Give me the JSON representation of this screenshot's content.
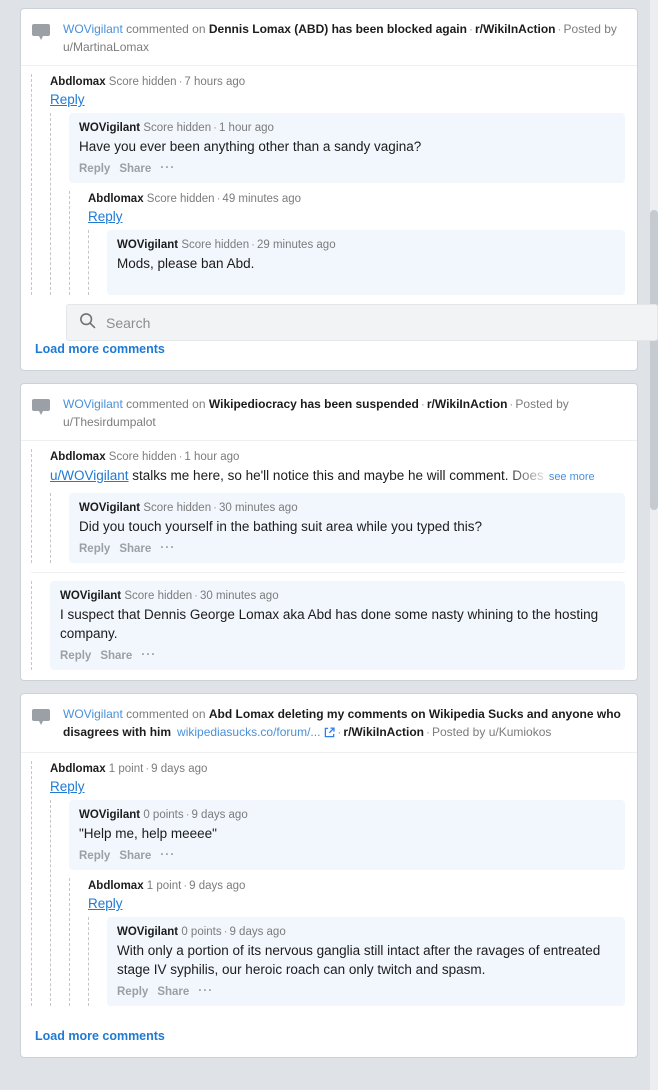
{
  "search": {
    "placeholder": "Search",
    "value": "",
    "icon": "search-icon"
  },
  "scroll": {
    "position_label": ""
  },
  "cards": [
    {
      "header": {
        "icon": "comment-bubble-icon",
        "user": "WOVigilant",
        "action": "commented on",
        "post_title": "Dennis Lomax (ABD) has been blocked again",
        "link_text": "",
        "link_icon": "",
        "subreddit": "r/WikiInAction",
        "posted_by_label": "Posted by",
        "poster": "u/MartinaLomax"
      },
      "load_more": "Load more comments",
      "comments": [
        {
          "author": "Abdlomax",
          "score": "Score hidden",
          "time": "7 hours ago",
          "reply_link": "Reply",
          "text": "",
          "highlighted": false,
          "actions": [],
          "depth": 0
        },
        {
          "author": "WOVigilant",
          "score": "Score hidden",
          "time": "1 hour ago",
          "reply_link": "",
          "text": "Have you ever been anything other than a sandy vagina?",
          "highlighted": true,
          "actions": [
            "Reply",
            "Share",
            "···"
          ],
          "depth": 1
        },
        {
          "author": "Abdlomax",
          "score": "Score hidden",
          "time": "49 minutes ago",
          "reply_link": "Reply",
          "text": "",
          "highlighted": false,
          "actions": [],
          "depth": 2
        },
        {
          "author": "WOVigilant",
          "score": "Score hidden",
          "time": "29 minutes ago",
          "reply_link": "",
          "text": "Mods, please ban Abd.",
          "highlighted": true,
          "actions": [],
          "depth": 3
        }
      ]
    },
    {
      "header": {
        "icon": "comment-bubble-icon",
        "user": "WOVigilant",
        "action": "commented on",
        "post_title": "Wikipediocracy has been suspended",
        "link_text": "",
        "link_icon": "",
        "subreddit": "r/WikiInAction",
        "posted_by_label": "Posted by",
        "poster": "u/Thesirdumpalot"
      },
      "load_more": "",
      "comments": [
        {
          "author": "Abdlomax",
          "score": "Score hidden",
          "time": "1 hour ago",
          "reply_link": "",
          "text_prefix_link": "u/WOVigilant",
          "text": " stalks me here, so he'll notice this and maybe he will comment. Does",
          "see_more": "see more",
          "truncated": true,
          "highlighted": false,
          "actions": [],
          "depth": 0
        },
        {
          "author": "WOVigilant",
          "score": "Score hidden",
          "time": "30 minutes ago",
          "reply_link": "",
          "text": "Did you touch yourself in the bathing suit area while you typed this?",
          "highlighted": true,
          "actions": [
            "Reply",
            "Share",
            "···"
          ],
          "depth": 1
        },
        {
          "author": "WOVigilant",
          "score": "Score hidden",
          "time": "30 minutes ago",
          "text": "I suspect that Dennis George Lomax aka Abd has done some nasty whining to the hosting company.",
          "highlighted": true,
          "actions": [
            "Reply",
            "Share",
            "···"
          ],
          "depth": 0,
          "divider_above": true
        }
      ]
    },
    {
      "header": {
        "icon": "comment-bubble-icon",
        "user": "WOVigilant",
        "action": "commented on",
        "post_title": "Abd Lomax deleting my comments on Wikipedia Sucks and anyone who disagrees with him",
        "link_text": "wikipediasucks.co/forum/...",
        "link_icon": "external-link-icon",
        "subreddit": "r/WikiInAction",
        "posted_by_label": "Posted by",
        "poster": "u/Kumiokos"
      },
      "load_more": "Load more comments",
      "comments": [
        {
          "author": "Abdlomax",
          "score": "1 point",
          "time": "9 days ago",
          "reply_link": "Reply",
          "text": "",
          "highlighted": false,
          "actions": [],
          "depth": 0
        },
        {
          "author": "WOVigilant",
          "score": "0 points",
          "time": "9 days ago",
          "reply_link": "",
          "text": "\"Help me, help meeee\"",
          "highlighted": true,
          "actions": [
            "Reply",
            "Share",
            "···"
          ],
          "depth": 1
        },
        {
          "author": "Abdlomax",
          "score": "1 point",
          "time": "9 days ago",
          "reply_link": "Reply",
          "text": "",
          "highlighted": false,
          "actions": [],
          "depth": 2
        },
        {
          "author": "WOVigilant",
          "score": "0 points",
          "time": "9 days ago",
          "reply_link": "",
          "text": "With only a portion of its nervous ganglia still intact after the ravages of entreated stage IV syphilis, our heroic roach can only twitch and spasm.",
          "highlighted": true,
          "actions": [
            "Reply",
            "Share",
            "···"
          ],
          "depth": 3
        }
      ]
    }
  ],
  "colors": {
    "page_bg": "#dfe3e8",
    "card_bg": "#ffffff",
    "bubble_bg": "#f2f6fd",
    "link_blue": "#1f7ad4",
    "muted": "#7c7c7c",
    "action_grey": "#9aa0a6"
  }
}
